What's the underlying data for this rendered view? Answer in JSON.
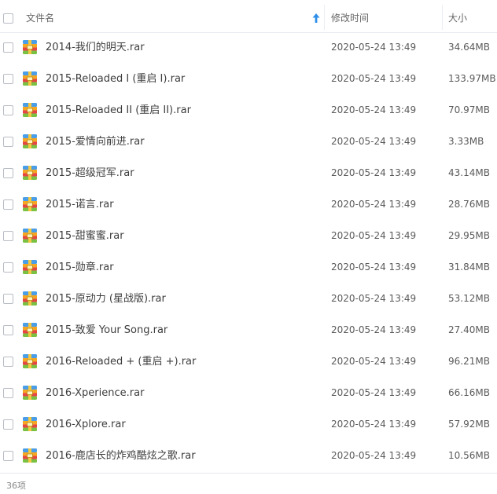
{
  "header": {
    "name_label": "文件名",
    "time_label": "修改时间",
    "size_label": "大小",
    "sort_icon": "sort-ascending-arrow-icon",
    "sort_color": "#2f8fe8"
  },
  "file_icon": "rar-archive-icon",
  "files": [
    {
      "name": "2014-我们的明天.rar",
      "time": "2020-05-24 13:49",
      "size": "34.64MB"
    },
    {
      "name": "2015-Reloaded I (重启 I).rar",
      "time": "2020-05-24 13:49",
      "size": "133.97MB"
    },
    {
      "name": "2015-Reloaded II (重启 II).rar",
      "time": "2020-05-24 13:49",
      "size": "70.97MB"
    },
    {
      "name": "2015-爱情向前进.rar",
      "time": "2020-05-24 13:49",
      "size": "3.33MB"
    },
    {
      "name": "2015-超级冠军.rar",
      "time": "2020-05-24 13:49",
      "size": "43.14MB"
    },
    {
      "name": "2015-诺言.rar",
      "time": "2020-05-24 13:49",
      "size": "28.76MB"
    },
    {
      "name": "2015-甜蜜蜜.rar",
      "time": "2020-05-24 13:49",
      "size": "29.95MB"
    },
    {
      "name": "2015-勋章.rar",
      "time": "2020-05-24 13:49",
      "size": "31.84MB"
    },
    {
      "name": "2015-原动力 (星战版).rar",
      "time": "2020-05-24 13:49",
      "size": "53.12MB"
    },
    {
      "name": "2015-致爱 Your Song.rar",
      "time": "2020-05-24 13:49",
      "size": "27.40MB"
    },
    {
      "name": "2016-Reloaded + (重启 +).rar",
      "time": "2020-05-24 13:49",
      "size": "96.21MB"
    },
    {
      "name": "2016-Xperience.rar",
      "time": "2020-05-24 13:49",
      "size": "66.16MB"
    },
    {
      "name": "2016-Xplore.rar",
      "time": "2020-05-24 13:49",
      "size": "57.92MB"
    },
    {
      "name": "2016-鹿店长的炸鸡酷炫之歌.rar",
      "time": "2020-05-24 13:49",
      "size": "10.56MB"
    }
  ],
  "footer": {
    "count_label": "36项"
  }
}
